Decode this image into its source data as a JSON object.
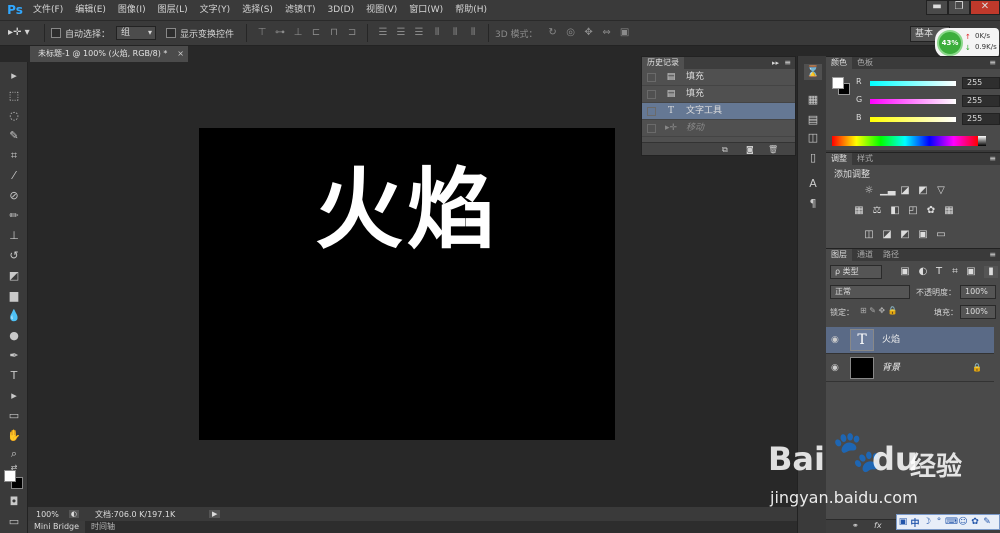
{
  "app": {
    "logo": "Ps"
  },
  "menu": [
    "文件(F)",
    "编辑(E)",
    "图像(I)",
    "图层(L)",
    "文字(Y)",
    "选择(S)",
    "滤镜(T)",
    "3D(D)",
    "视图(V)",
    "窗口(W)",
    "帮助(H)"
  ],
  "window_controls": {
    "minimize": "▬",
    "restore": "❐",
    "close": "✕"
  },
  "options": {
    "auto_select_label": "自动选择：",
    "auto_select_value": "组",
    "show_transform_label": "显示变换控件",
    "mode_3d_label": "3D 模式：",
    "workspace": "基本"
  },
  "network": {
    "percent": "43%",
    "up": "0K/s",
    "down": "0.9K/s"
  },
  "document": {
    "tab_title": "未标题-1 @ 100% (火焰, RGB/8) *",
    "tab_close": "×",
    "canvas_text": "火焰"
  },
  "status": {
    "zoom": "100%",
    "doc_size": "文档:706.0 K/197.1K"
  },
  "bottom_tabs": [
    "Mini Bridge",
    "时间轴"
  ],
  "history": {
    "title": "历史记录",
    "items": [
      {
        "label": "填充",
        "icon": "fill-icon"
      },
      {
        "label": "填充",
        "icon": "fill-icon"
      },
      {
        "label": "文字工具",
        "icon": "type-icon"
      },
      {
        "label": "移动",
        "icon": "move-icon"
      }
    ]
  },
  "color_panel": {
    "tabs": [
      "颜色",
      "色板"
    ],
    "channels": [
      {
        "name": "R",
        "value": "255",
        "color": "#00ffff"
      },
      {
        "name": "G",
        "value": "255",
        "color": "#ff00ff"
      },
      {
        "name": "B",
        "value": "255",
        "color": "#ffff00"
      }
    ]
  },
  "adjustments": {
    "tabs": [
      "调整",
      "样式"
    ],
    "title": "添加调整"
  },
  "layers": {
    "tabs": [
      "图层",
      "通道",
      "路径"
    ],
    "kind_label": "ρ 类型",
    "blend_mode": "正常",
    "opacity_label": "不透明度：",
    "opacity_value": "100%",
    "lock_label": "锁定：",
    "fill_label": "填充：",
    "fill_value": "100%",
    "rows": [
      {
        "name": "火焰",
        "type": "text"
      },
      {
        "name": "背景",
        "type": "background"
      }
    ]
  },
  "watermark": {
    "logo": "Bai",
    "logo2": "du",
    "brand": "经验",
    "url": "jingyan.baidu.com"
  },
  "ime": {
    "label": "中"
  }
}
